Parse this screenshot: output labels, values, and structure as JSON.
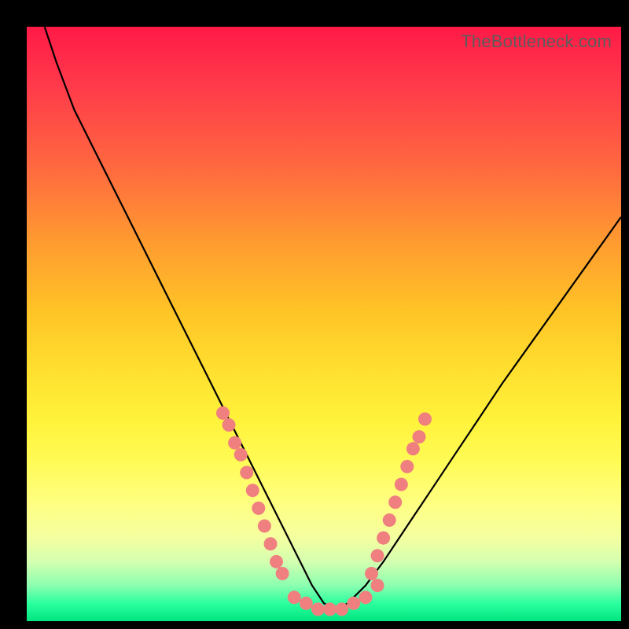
{
  "watermark": "TheBottleneck.com",
  "colors": {
    "curve_stroke": "#000000",
    "dot_fill": "#f08080",
    "frame_bg": "#000000"
  },
  "chart_data": {
    "type": "line",
    "title": "",
    "xlabel": "",
    "ylabel": "",
    "xlim": [
      0,
      100
    ],
    "ylim": [
      0,
      100
    ],
    "grid": false,
    "legend": false,
    "series": [
      {
        "name": "bottleneck-curve",
        "x": [
          3,
          5,
          8,
          12,
          16,
          20,
          24,
          28,
          31,
          34,
          37,
          40,
          43,
          46,
          48,
          50,
          52,
          54,
          57,
          60,
          64,
          68,
          72,
          76,
          80,
          85,
          90,
          95,
          100
        ],
        "y": [
          100,
          94,
          86,
          78,
          70,
          62,
          54,
          46,
          40,
          34,
          28,
          22,
          16,
          10,
          6,
          3,
          2,
          3,
          6,
          10,
          16,
          22,
          28,
          34,
          40,
          47,
          54,
          61,
          68
        ]
      }
    ],
    "annotations": {
      "dots_left_cluster_x": [
        33,
        34,
        35,
        36,
        37,
        38,
        39,
        40,
        41,
        42,
        43
      ],
      "dots_left_cluster_y": [
        35,
        33,
        30,
        28,
        25,
        22,
        19,
        16,
        13,
        10,
        8
      ],
      "dots_bottom_cluster_x": [
        45,
        47,
        49,
        51,
        53,
        55,
        57,
        59
      ],
      "dots_bottom_cluster_y": [
        4,
        3,
        2,
        2,
        2,
        3,
        4,
        6
      ],
      "dots_right_cluster_x": [
        58,
        59,
        60,
        61,
        62,
        63,
        64,
        65,
        66,
        67
      ],
      "dots_right_cluster_y": [
        8,
        11,
        14,
        17,
        20,
        23,
        26,
        29,
        31,
        34
      ]
    }
  }
}
